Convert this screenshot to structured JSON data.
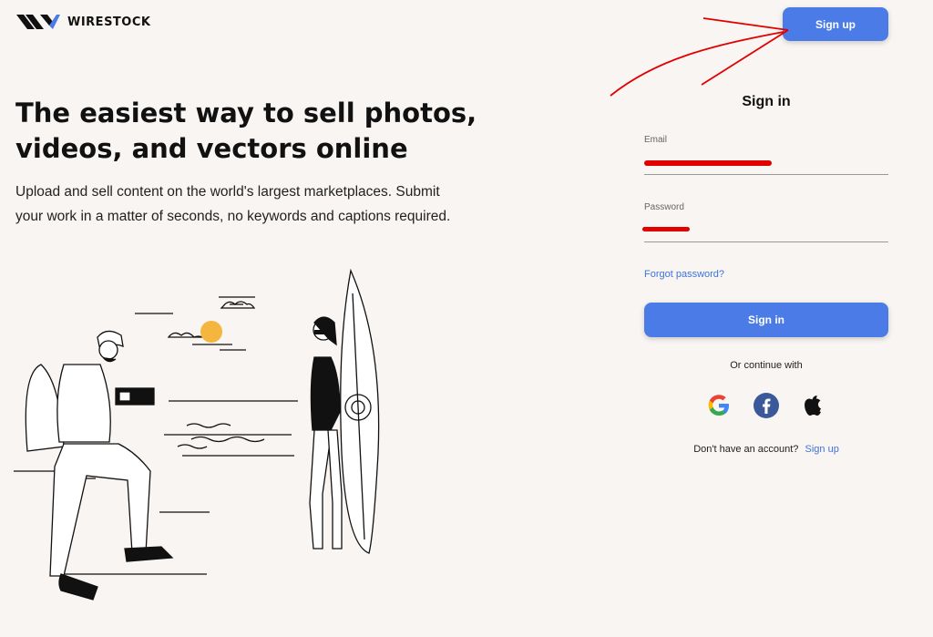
{
  "header": {
    "logo_text": "WIRESTOCK",
    "signup_label": "Sign up"
  },
  "hero": {
    "title": "The easiest way to sell photos, videos, and vectors online",
    "subtitle": "Upload and sell content on the world's largest marketplaces. Submit your work in a matter of seconds, no keywords and captions required."
  },
  "signin": {
    "title": "Sign in",
    "email_label": "Email",
    "password_label": "Password",
    "forgot_label": "Forgot password?",
    "button_label": "Sign in",
    "or_text": "Or continue with",
    "social": [
      "google-icon",
      "facebook-icon",
      "apple-icon"
    ],
    "no_account_text": "Don't have an account?",
    "signup_link": "Sign up"
  },
  "colors": {
    "accent": "#4a7be6",
    "link": "#3f74d9",
    "background": "#f8f5f2",
    "annotation": "#e10000",
    "sun": "#f4b63f"
  }
}
